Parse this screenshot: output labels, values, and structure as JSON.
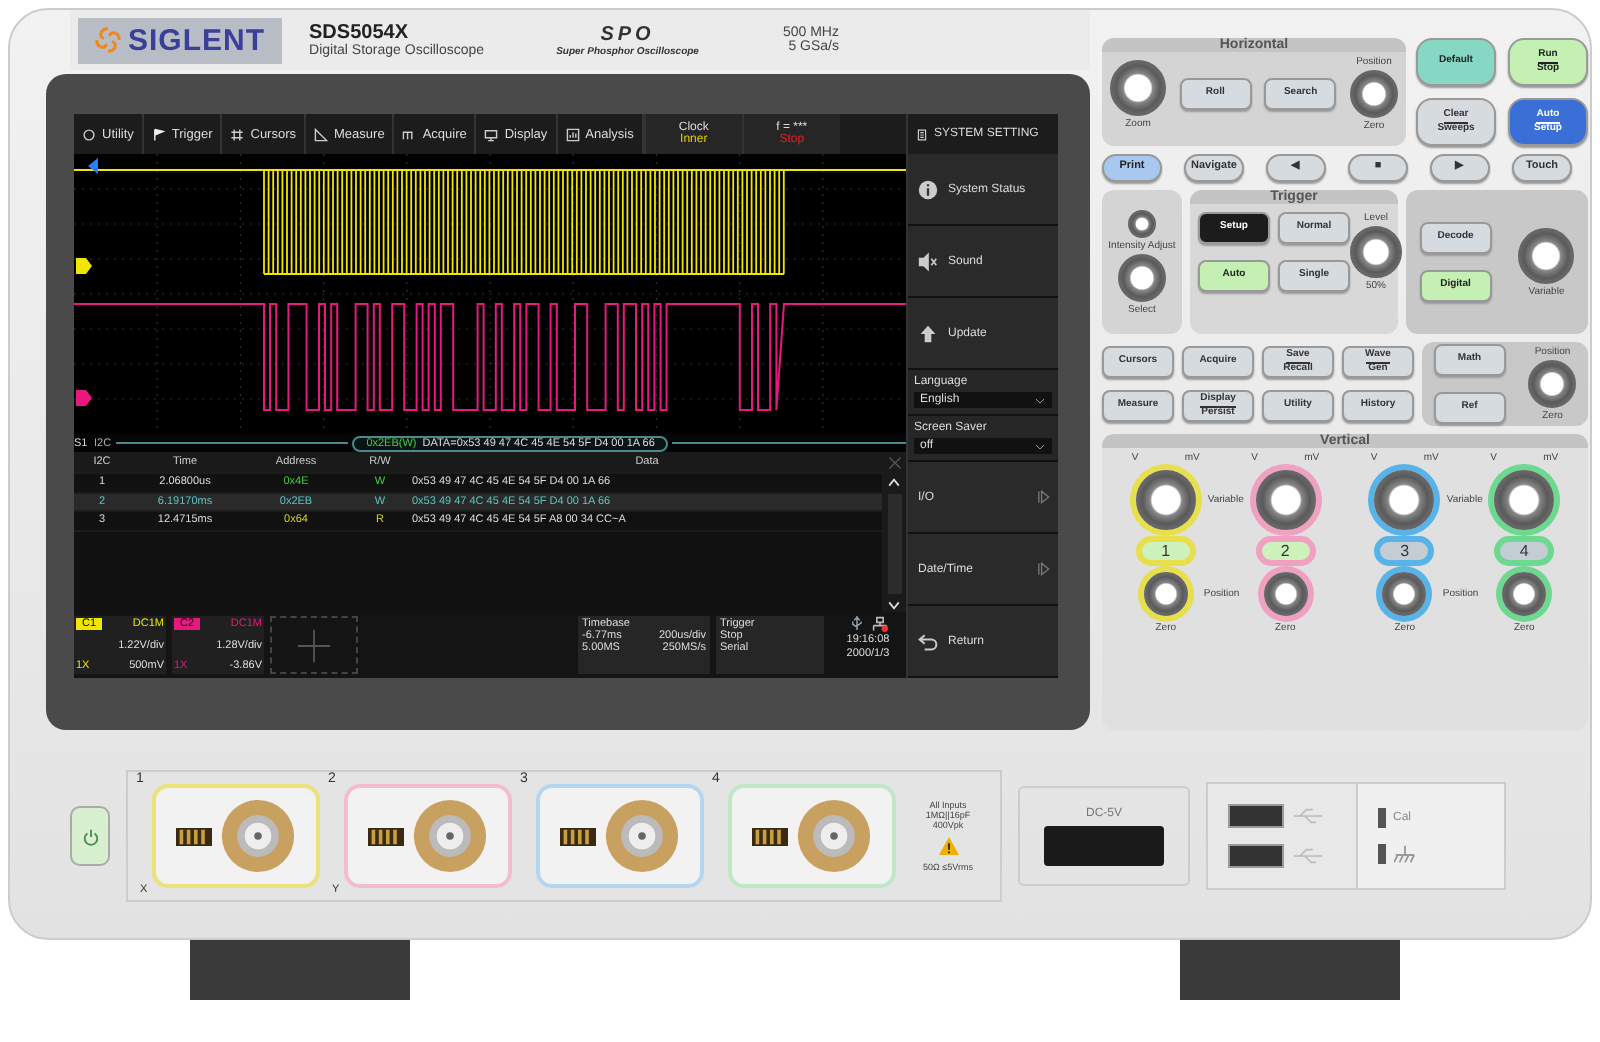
{
  "header": {
    "brand": "SIGLENT",
    "model": "SDS5054X",
    "subtitle": "Digital Storage Oscilloscope",
    "series_logo": "SPO",
    "series_name": "Super Phosphor Oscilloscope",
    "bandwidth": "500 MHz",
    "sample_rate": "5 GSa/s"
  },
  "screen": {
    "menu": [
      {
        "label": "Utility"
      },
      {
        "label": "Trigger"
      },
      {
        "label": "Cursors"
      },
      {
        "label": "Measure"
      },
      {
        "label": "Acquire"
      },
      {
        "label": "Display"
      },
      {
        "label": "Analysis"
      }
    ],
    "clock": {
      "label": "Clock",
      "value": "Inner"
    },
    "frequency": {
      "label": "f = ***",
      "value": "Stop"
    },
    "decode": {
      "bus": "S1",
      "protocol": "I2C",
      "frame": "0x2EB(W)",
      "data": "DATA=0x53 49 47 4C 45 4E 54 5F D4 00 1A 66"
    },
    "table": {
      "columns": [
        "I2C",
        "Time",
        "Address",
        "R/W",
        "Data"
      ],
      "rows": [
        {
          "selected": false,
          "color": "#3fd03f",
          "cells": [
            "1",
            "2.06800us",
            "0x4E",
            "W",
            "0x53 49 47 4C 45 4E 54 5F D4 00 1A 66"
          ]
        },
        {
          "selected": true,
          "color": "#5cc4c4",
          "cells": [
            "2",
            "6.19170ms",
            "0x2EB",
            "W",
            "0x53 49 47 4C 45 4E 54 5F D4 00 1A 66"
          ]
        },
        {
          "selected": false,
          "color": "#d6d21e",
          "cells": [
            "3",
            "12.4715ms",
            "0x64",
            "R",
            "0x53 49 47 4C 45 4E 54 5F A8 00 34 CC~A"
          ]
        }
      ]
    },
    "channels": [
      {
        "name": "C1",
        "coupling": "DC1M",
        "scale": "1.22V/div",
        "probe": "1X",
        "offset": "500mV",
        "color": "#f0e600"
      },
      {
        "name": "C2",
        "coupling": "DC1M",
        "scale": "1.28V/div",
        "probe": "1X",
        "offset": "-3.86V",
        "color": "#e8187f"
      }
    ],
    "timebase": {
      "label": "Timebase",
      "delay": "-6.77ms",
      "scale": "200us/div",
      "memory": "5.00MS",
      "rate": "250MS/s"
    },
    "trigger": {
      "label": "Trigger",
      "state": "Stop",
      "type": "Serial"
    },
    "time": "19:16:08",
    "date": "2000/1/3",
    "side_menu": {
      "title": "SYSTEM SETTING",
      "items": [
        {
          "kind": "button",
          "label": "System Status"
        },
        {
          "kind": "button",
          "label": "Sound"
        },
        {
          "kind": "button",
          "label": "Update"
        },
        {
          "kind": "select",
          "label": "Language",
          "value": "English"
        },
        {
          "kind": "select",
          "label": "Screen Saver",
          "value": "off"
        },
        {
          "kind": "submenu",
          "label": "I/O"
        },
        {
          "kind": "submenu",
          "label": "Date/Time"
        },
        {
          "kind": "button",
          "label": "Return"
        }
      ]
    }
  },
  "panel": {
    "horizontal": {
      "title": "Horizontal",
      "zoom": "Zoom",
      "buttons": [
        {
          "lines": [
            "Roll"
          ],
          "lit": false
        },
        {
          "lines": [
            "Search"
          ],
          "lit": false
        }
      ],
      "position": "Position",
      "zero": "Zero"
    },
    "top_buttons": [
      {
        "lines": [
          "Default"
        ],
        "lit": true,
        "color": "#86d8c4"
      },
      {
        "lines": [
          "Run",
          "Stop"
        ],
        "lit": true,
        "color": "#c4f0b4"
      },
      {
        "lines": [
          "Clear",
          "Sweeps"
        ],
        "lit": false
      },
      {
        "lines": [
          "Auto",
          "Setup"
        ],
        "lit": true,
        "color": "#3a6fd8"
      }
    ],
    "nav_buttons": [
      {
        "lines": [
          "Print"
        ],
        "lit": true,
        "color": "#a9c8f0"
      },
      {
        "lines": [
          "Navigate"
        ],
        "lit": false
      },
      {
        "lines": [
          "◀"
        ],
        "lit": false
      },
      {
        "lines": [
          "■"
        ],
        "lit": false
      },
      {
        "lines": [
          "▶"
        ],
        "lit": false
      },
      {
        "lines": [
          "Touch"
        ],
        "lit": false
      }
    ],
    "intensity": {
      "label": "Intensity Adjust",
      "select": "Select"
    },
    "trigger": {
      "title": "Trigger",
      "buttons": [
        {
          "lines": [
            "Setup"
          ],
          "lit": true,
          "color": "#1c1c1c"
        },
        {
          "lines": [
            "Normal"
          ],
          "lit": false
        },
        {
          "lines": [
            "Auto"
          ],
          "lit": true,
          "color": "#c4f0b4"
        },
        {
          "lines": [
            "Single"
          ],
          "lit": false
        }
      ],
      "level": "Level",
      "percent": "50%"
    },
    "decode_buttons": [
      {
        "lines": [
          "Decode"
        ],
        "lit": false
      },
      {
        "lines": [
          "Digital"
        ],
        "lit": true,
        "color": "#c4f0b4"
      }
    ],
    "decode_variable": "Variable",
    "func_buttons": [
      {
        "lines": [
          "Cursors"
        ],
        "lit": false
      },
      {
        "lines": [
          "Acquire"
        ],
        "lit": false
      },
      {
        "lines": [
          "Save",
          "Recall"
        ],
        "lit": false
      },
      {
        "lines": [
          "Wave",
          "Gen"
        ],
        "lit": false
      },
      {
        "lines": [
          "Measure"
        ],
        "lit": false
      },
      {
        "lines": [
          "Display",
          "Persist"
        ],
        "lit": false
      },
      {
        "lines": [
          "Utility"
        ],
        "lit": false
      },
      {
        "lines": [
          "History"
        ],
        "lit": false
      }
    ],
    "math_buttons": [
      {
        "lines": [
          "Math"
        ],
        "lit": false
      },
      {
        "lines": [
          "Ref"
        ],
        "lit": false
      }
    ],
    "math_position": "Position",
    "math_zero": "Zero",
    "vertical": {
      "title": "Vertical",
      "channels": [
        {
          "label": "1",
          "lit": true,
          "color": "#e8df4c",
          "low": "V",
          "high": "mV",
          "variable": "Variable",
          "position": "Position",
          "zero": "Zero"
        },
        {
          "label": "2",
          "lit": true,
          "color": "#f0a0c0",
          "low": "V",
          "high": "mV",
          "zero": "Zero"
        },
        {
          "label": "3",
          "lit": false,
          "color": "#58b4e8",
          "low": "V",
          "high": "mV",
          "variable": "Variable",
          "position": "Position",
          "zero": "Zero"
        },
        {
          "label": "4",
          "lit": false,
          "color": "#6cd890",
          "low": "V",
          "high": "mV",
          "zero": "Zero"
        }
      ]
    }
  },
  "front": {
    "inputs": [
      {
        "label": "1",
        "sub": "X",
        "color": "#ece27a"
      },
      {
        "label": "2",
        "sub": "Y",
        "color": "#f4bcd0"
      },
      {
        "label": "3",
        "color": "#b4d6f0"
      },
      {
        "label": "4",
        "color": "#c0e8c8"
      }
    ],
    "input_spec": [
      "All Inputs",
      "1MΩ||16pF",
      "400Vpk"
    ],
    "warning": "50Ω ≤5Vrms",
    "dc_label": "DC-5V",
    "cal": "Cal"
  }
}
